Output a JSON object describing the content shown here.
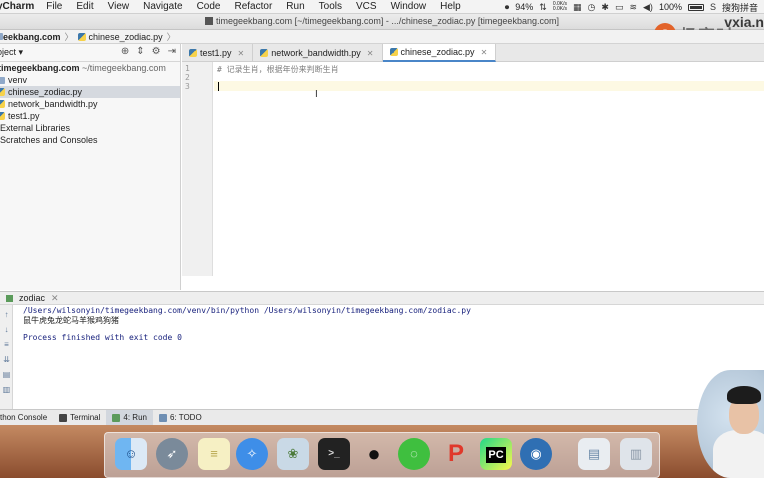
{
  "menubar": {
    "app": "yCharm",
    "menus": [
      "File",
      "Edit",
      "View",
      "Navigate",
      "Code",
      "Refactor",
      "Run",
      "Tools",
      "VCS",
      "Window",
      "Help"
    ],
    "battery_text": "94%",
    "net_up": "0.0K/s",
    "net_down": "0.0K/s",
    "battery2": "100%",
    "ime": "搜狗拼音"
  },
  "window": {
    "title": "timegeekbang.com [~/timegeekbang.com] - .../chinese_zodiac.py [timegeekbang.com]",
    "logo_text": "极客时",
    "site_text": "vxia.n"
  },
  "navbar": {
    "root": "eekbang.com",
    "file": "chinese_zodiac.py"
  },
  "project": {
    "header": "oject",
    "root_name": "timegeekbang.com",
    "root_path": "~/timegeekbang.com",
    "items": [
      {
        "label": "venv",
        "kind": "folder"
      },
      {
        "label": "chinese_zodiac.py",
        "kind": "py",
        "selected": true
      },
      {
        "label": "network_bandwidth.py",
        "kind": "py"
      },
      {
        "label": "test1.py",
        "kind": "py"
      },
      {
        "label": "External Libraries",
        "kind": "lib"
      },
      {
        "label": "Scratches and Consoles",
        "kind": "scratch"
      }
    ]
  },
  "editor": {
    "tabs": [
      {
        "label": "test1.py",
        "active": false
      },
      {
        "label": "network_bandwidth.py",
        "active": false
      },
      {
        "label": "chinese_zodiac.py",
        "active": true
      }
    ],
    "line_numbers": [
      "1",
      "2",
      "3"
    ],
    "lines": [
      "# 记录生肖，根据年份来判断生肖",
      "",
      ""
    ]
  },
  "run": {
    "tab_label": "zodiac",
    "command": "/Users/wilsonyin/timegeekbang.com/venv/bin/python /Users/wilsonyin/timegeekbang.com/zodiac.py",
    "output": "鼠牛虎兔龙蛇马羊猴鸡狗猪",
    "exit_message": "Process finished with exit code 0"
  },
  "toolwindows": [
    {
      "label": "thon Console",
      "active": false
    },
    {
      "label": "Terminal",
      "active": false
    },
    {
      "label": "4: Run",
      "active": true
    },
    {
      "label": "6: TODO",
      "active": false
    }
  ],
  "dock": {
    "icons": [
      "finder-icon",
      "launchpad-icon",
      "notes-icon",
      "safari-icon",
      "preview-icon",
      "terminal-icon",
      "qq-icon",
      "wechat-icon",
      "wps-icon",
      "pycharm-icon",
      "quicktime-icon",
      "downloads-icon",
      "trash-icon"
    ],
    "pycharm_label": "PC"
  }
}
